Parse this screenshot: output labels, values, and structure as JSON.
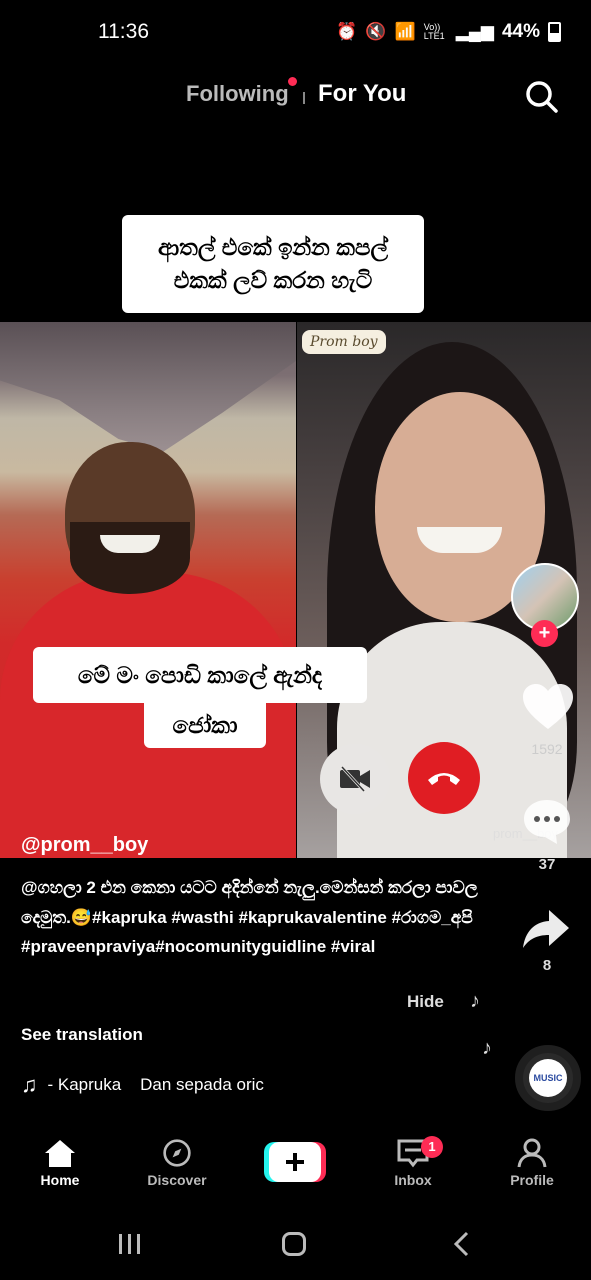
{
  "status_bar": {
    "time": "11:36",
    "network": "Vo)) LTE1",
    "battery": "44%"
  },
  "top_nav": {
    "following": "Following",
    "for_you": "For You"
  },
  "video": {
    "caption_top_line1": "ආතල් එකේ ඉන්න කපල්",
    "caption_top_line2": "එකක් ලව් කරන හැටි",
    "caption_mid_line1": "මේ මං පොඩි කාලේ ඇන්ද",
    "caption_mid_line2": "ජෝකා",
    "sticker": "Prom boy",
    "watermark": "prom__boy"
  },
  "rail": {
    "like_count": "1592",
    "comment_count": "37",
    "share_count": "8",
    "disc_label": "MUSIC"
  },
  "post": {
    "username": "@prom__boy",
    "description": "@ගහලා 2 එන කෙනා යටට අදින්නේ නැලු.මෙන්සන් කරලා පාවල දෙමුත.😅#kapruka #wasthi #kaprukavalentine #රාගම_අපි #praveenpraviya#nocomunityguidline #viral",
    "hide": "Hide",
    "see_translation": "See translation",
    "music": "- Kapruka    Dan sepada oric"
  },
  "bottom_nav": {
    "home": "Home",
    "discover": "Discover",
    "inbox": "Inbox",
    "inbox_badge": "1",
    "profile": "Profile"
  },
  "colors": {
    "accent": "#fe2c55",
    "end_call": "#e01d23",
    "shirt": "#d8272b"
  }
}
